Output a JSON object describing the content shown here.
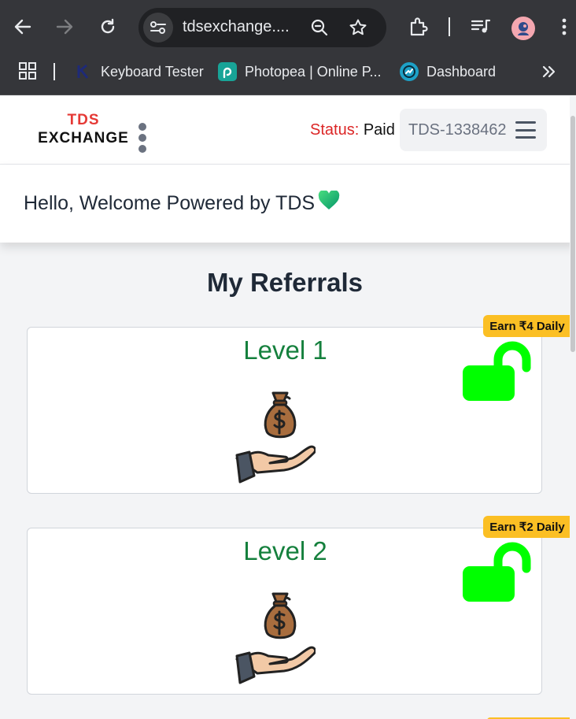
{
  "browser": {
    "url": "tdsexchange....",
    "bookmarks": [
      {
        "label": "Keyboard Tester",
        "icon": "keyboard-tester-favicon"
      },
      {
        "label": "Photopea | Online P...",
        "icon": "photopea-favicon"
      },
      {
        "label": "Dashboard",
        "icon": "dashboard-favicon"
      }
    ],
    "icons": [
      "back-arrow-icon",
      "forward-arrow-icon",
      "reload-icon",
      "site-settings-icon",
      "zoom-icon",
      "bookmark-star-icon",
      "extensions-icon",
      "media-queue-icon",
      "profile-avatar",
      "more-menu-icon",
      "apps-grid-icon",
      "bookmarks-overflow-icon"
    ]
  },
  "header": {
    "logo_top": "TDS",
    "logo_bottom": "EXCHANGE",
    "status_label": "Status:",
    "status_value": "Paid",
    "user_id": "TDS-1338462"
  },
  "welcome": {
    "text": "Hello, Welcome Powered by TDS",
    "emoji": "💚"
  },
  "referrals": {
    "title": "My Referrals",
    "levels": [
      {
        "label": "Level 1",
        "badge": "Earn ₹4 Daily",
        "lock_icon": "unlocked-padlock-icon",
        "illustration": "money-bag-hand-icon"
      },
      {
        "label": "Level 2",
        "badge": "Earn ₹2 Daily",
        "lock_icon": "unlocked-padlock-icon",
        "illustration": "money-bag-hand-icon"
      }
    ]
  },
  "colors": {
    "browser_bg": "#35363a",
    "logo_red": "#e53935",
    "status_red": "#dc2626",
    "level_green": "#15803d",
    "lock_green": "#00ff00",
    "badge_yellow": "#fbbf24"
  }
}
